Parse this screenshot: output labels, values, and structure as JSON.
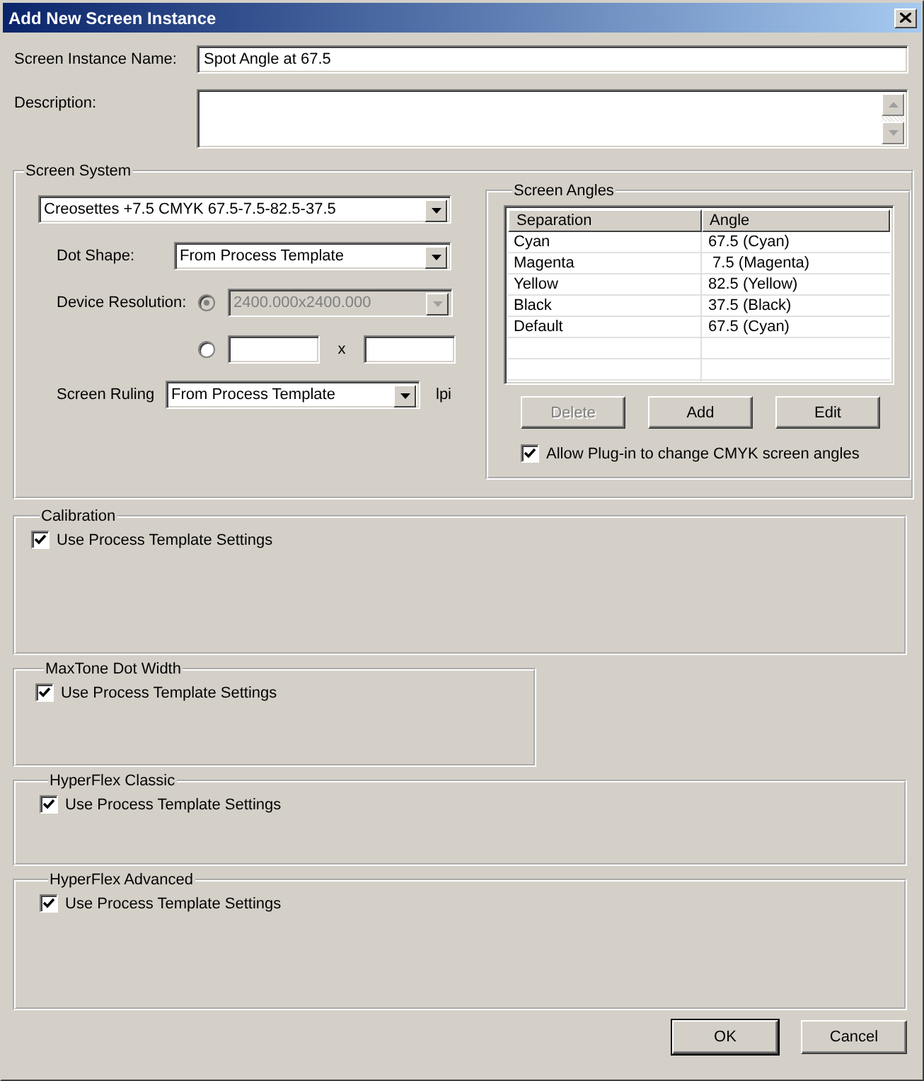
{
  "window": {
    "title": "Add New Screen Instance"
  },
  "name_field": {
    "label": "Screen Instance Name:",
    "value": "Spot Angle at 67.5"
  },
  "description_field": {
    "label": "Description:"
  },
  "screen_system": {
    "title": "Screen System",
    "screen_set": {
      "value": "Creosettes +7.5 CMYK 67.5-7.5-82.5-37.5"
    },
    "dot_shape": {
      "label": "Dot Shape:",
      "value": "From Process Template"
    },
    "device_resolution": {
      "label": "Device Resolution:",
      "options": [
        {
          "kind": "preset",
          "selected": true,
          "disabled": true,
          "value": "2400.000x2400.000"
        },
        {
          "kind": "custom",
          "selected": false,
          "disabled": false,
          "separator": "x"
        }
      ]
    },
    "screen_ruling": {
      "label": "Screen Ruling",
      "value": "From Process Template",
      "unit": "lpi"
    },
    "screen_angles": {
      "title": "Screen Angles",
      "columns": [
        "Separation",
        "Angle"
      ],
      "rows": [
        {
          "separation": "Cyan",
          "angle": "67.5 (Cyan)"
        },
        {
          "separation": "Magenta",
          "angle": " 7.5 (Magenta)"
        },
        {
          "separation": "Yellow",
          "angle": "82.5 (Yellow)"
        },
        {
          "separation": "Black",
          "angle": "37.5 (Black)"
        },
        {
          "separation": "Default",
          "angle": "67.5 (Cyan)"
        }
      ],
      "buttons": [
        {
          "label": "Delete",
          "disabled": true
        },
        {
          "label": "Add",
          "disabled": false
        },
        {
          "label": "Edit",
          "disabled": false
        }
      ],
      "allow_plugin": {
        "label": "Allow Plug-in to change CMYK screen angles",
        "checked": true
      }
    }
  },
  "sections": [
    {
      "title": "Calibration",
      "kind": "wide",
      "checkbox": {
        "label": "Use Process Template Settings",
        "checked": true
      }
    },
    {
      "title": "MaxTone Dot Width",
      "kind": "narrow",
      "checkbox": {
        "label": "Use Process Template Settings",
        "checked": true
      }
    },
    {
      "title": "HyperFlex Classic",
      "kind": "wide",
      "checkbox": {
        "label": "Use Process Template Settings",
        "checked": true
      }
    },
    {
      "title": "HyperFlex Advanced",
      "kind": "wide",
      "checkbox": {
        "label": "Use Process Template Settings",
        "checked": true
      }
    }
  ],
  "buttons": [
    {
      "label": "OK"
    },
    {
      "label": "Cancel"
    }
  ]
}
